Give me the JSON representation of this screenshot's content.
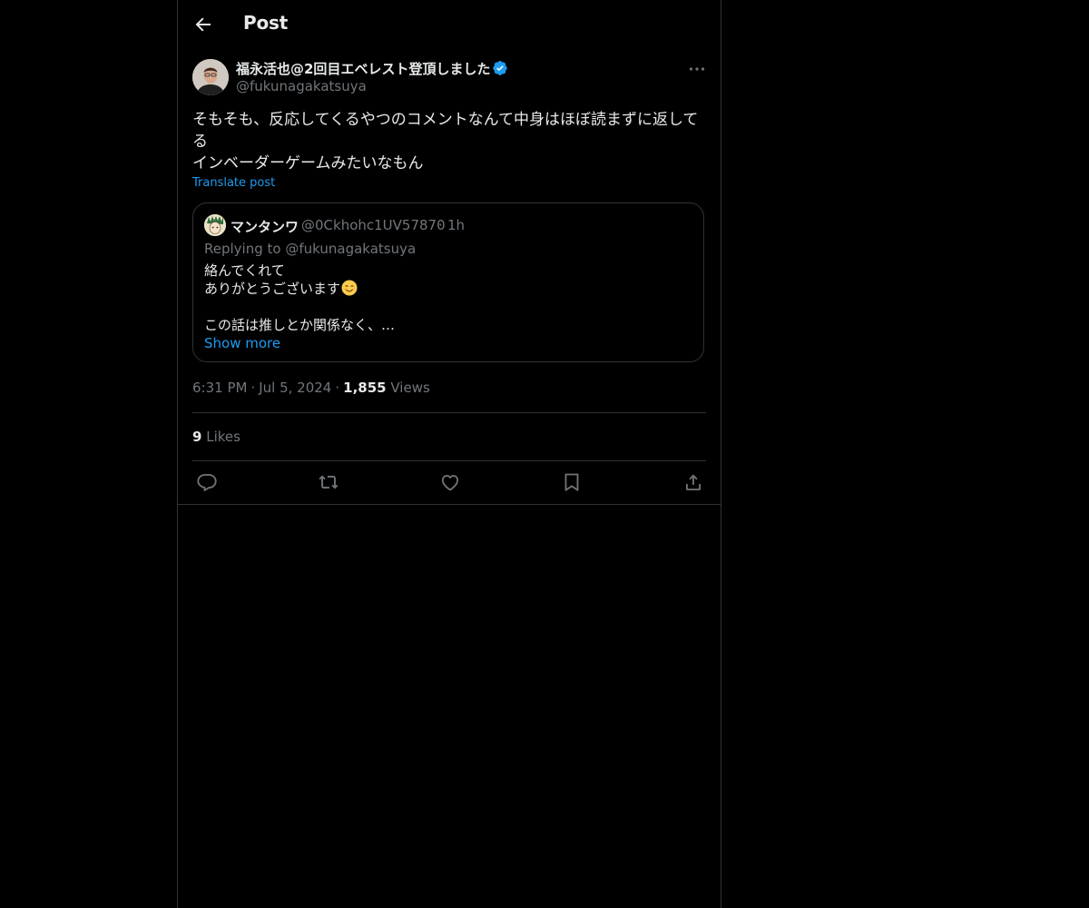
{
  "header": {
    "title": "Post"
  },
  "post": {
    "author_name": "福永活也@2回目エベレスト登頂しました",
    "author_handle": "@fukunagakatsuya",
    "text_lines": [
      "そもそも、反応してくるやつのコメントなんて中身はほぼ読まずに返して",
      "る",
      "インベーダーゲームみたいなもん"
    ],
    "translate_label": "Translate post",
    "time": "6:31 PM",
    "date": "Jul 5, 2024",
    "views_count": "1,855",
    "views_label": "Views",
    "likes_count": "9",
    "likes_label": "Likes"
  },
  "quote": {
    "author_name": "マンタンワ",
    "author_handle": "@0Ckhohc1UV57870",
    "time": "1h",
    "replying_prefix": "Replying to",
    "replying_handle": "@fukunagakatsuya",
    "text_lines": [
      "絡んでくれて",
      "ありがとうございます",
      "",
      "この話は推しとか関係なく、…"
    ],
    "show_more": "Show more"
  },
  "colors": {
    "accent": "#1d9bf0",
    "muted": "#71767b",
    "border": "#2f3336",
    "text": "#e7e9ea",
    "background": "#000000"
  },
  "icons": [
    "back-arrow-icon",
    "verified-badge-icon",
    "more-icon",
    "reply-icon",
    "repost-icon",
    "like-icon",
    "bookmark-icon",
    "share-icon",
    "smiling-face-emoji"
  ]
}
